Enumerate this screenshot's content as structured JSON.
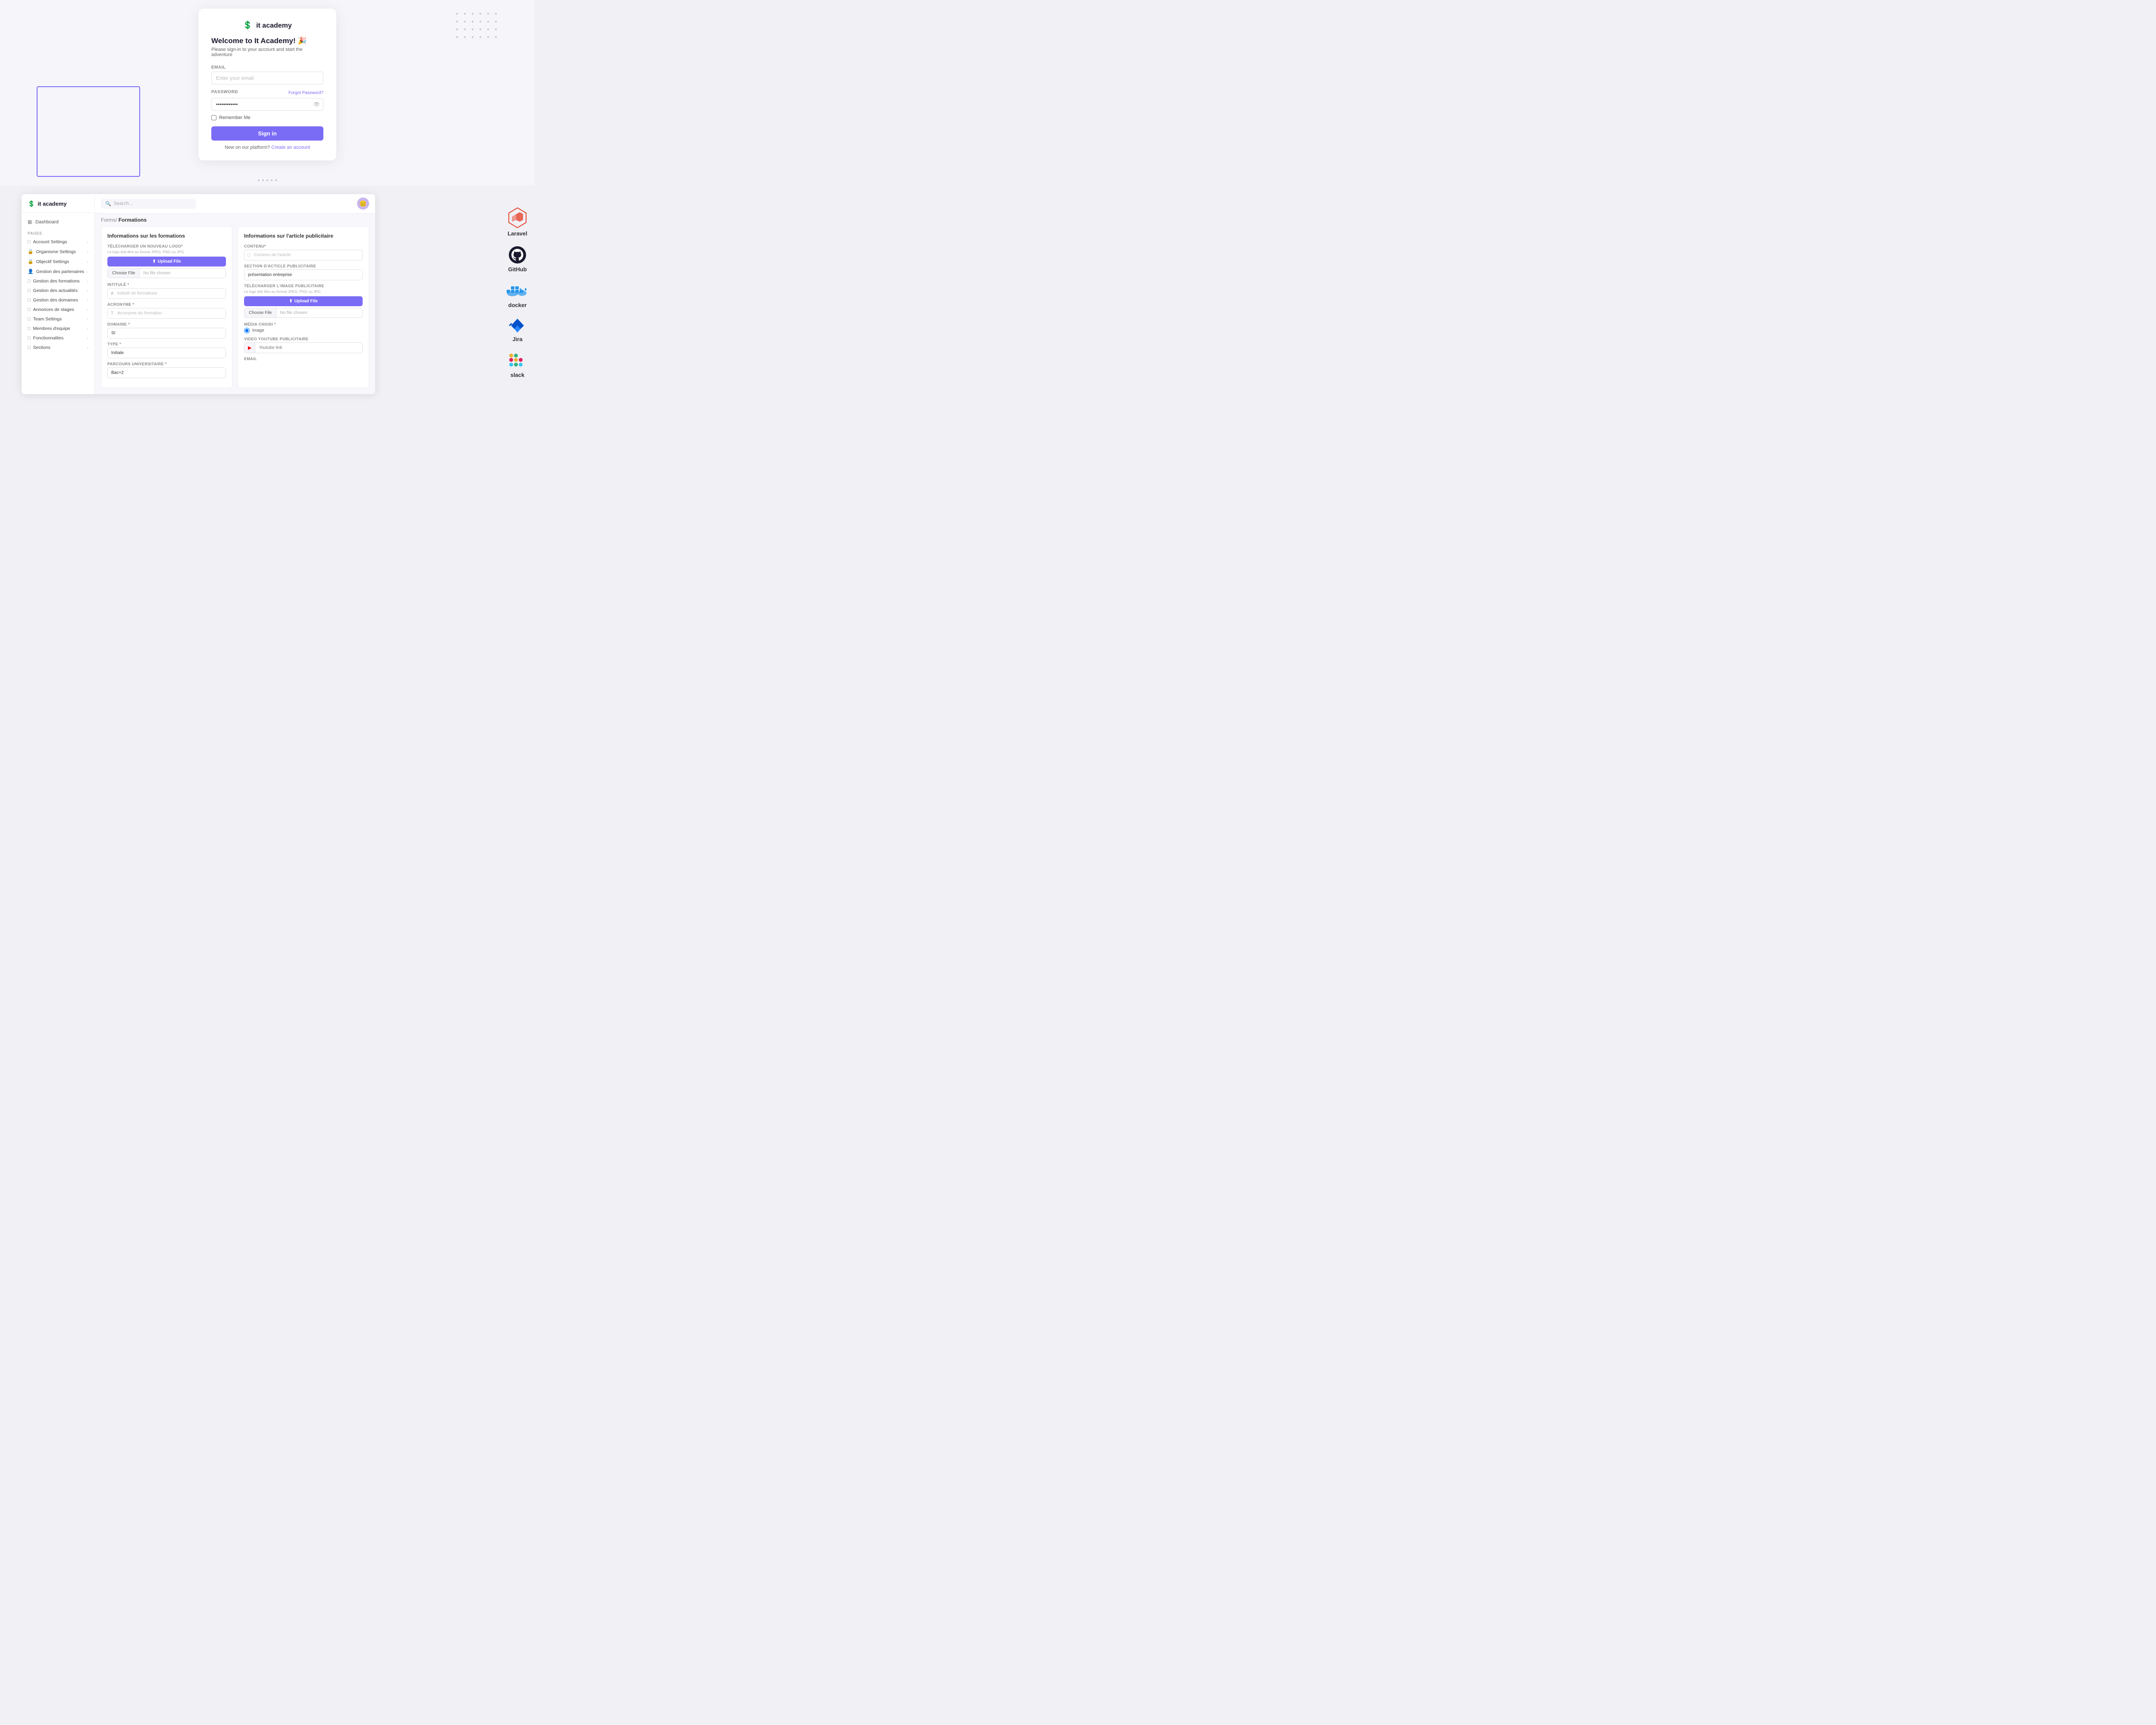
{
  "topSection": {
    "loginCard": {
      "logoIcon": "💲",
      "logoText": "it academy",
      "title": "Welcome to It Academy! 🎉",
      "subtitle": "Please sign-in to your account and start the adventure",
      "emailLabel": "EMAIL",
      "emailPlaceholder": "Enter your email",
      "passwordLabel": "PASSWORD",
      "forgotLink": "Forgot Password?",
      "passwordValue": "············",
      "rememberLabel": "Remember Me",
      "signInButton": "Sign in",
      "newOnPlatform": "New on our platform?",
      "createAccountLink": "Create an account"
    }
  },
  "sidebar": {
    "logoIcon": "💲",
    "logoText": "it academy",
    "dashboardLabel": "Dashboard",
    "pagesLabel": "PAGES",
    "items": [
      {
        "icon": "□",
        "label": "Account Settings",
        "hasChevron": true
      },
      {
        "icon": "🔒",
        "label": "Organisme Settings",
        "hasChevron": true
      },
      {
        "icon": "🔒",
        "label": "Objectif Settings",
        "hasChevron": true
      },
      {
        "icon": "👤",
        "label": "Gestion des partenaires",
        "hasChevron": true
      },
      {
        "icon": "□",
        "label": "Gestion des formations",
        "hasChevron": true
      },
      {
        "icon": "□",
        "label": "Gestion des actualités",
        "hasChevron": true
      },
      {
        "icon": "□",
        "label": "Gestion des domaines",
        "hasChevron": true
      },
      {
        "icon": "□",
        "label": "Annonces de stages",
        "hasChevron": true
      },
      {
        "icon": "□",
        "label": "Team Settings",
        "hasChevron": true
      },
      {
        "icon": "□",
        "label": "Membres d'equipe",
        "hasChevron": true
      },
      {
        "icon": "□",
        "label": "Fonctionnalites",
        "hasChevron": true
      },
      {
        "icon": "□",
        "label": "Sections",
        "hasChevron": true
      }
    ]
  },
  "topBar": {
    "searchPlaceholder": "Search...",
    "avatarAlt": "user avatar"
  },
  "breadcrumb": {
    "link": "Forms/",
    "current": "Formations"
  },
  "leftPanel": {
    "title": "Informations sur les formations",
    "logoSection": {
      "label": "TÉLÉCHARGER UN NOUVEAU LOGO*",
      "hint": "Le logo doit être au format JPEG, PNG ou JPG",
      "uploadButton": "Upload File",
      "chooseFileButton": "Choose File",
      "fileChosen": "No file chosen"
    },
    "intituleLabel": "INTITULÉ *",
    "intitulePlaceholder": "Intitulé de formations",
    "acronymeLabel": "ACRONYME *",
    "acronymePlaceholder": "Acronyme du formation",
    "domaineLabel": "DOMAINE *",
    "domaineValue": "SI",
    "typeLabel": "TYPE *",
    "typeValue": "Initiale",
    "parcoursLabel": "PARCOURS UNIVERSITAIRE *",
    "parcoursValue": "Bac+2"
  },
  "rightPanel": {
    "title": "Informations sur l'article publicitaire",
    "contenuLabel": "CONTENU*",
    "contenuPlaceholder": "Contenu de l'article",
    "sectionLabel": "SECTION D'ACTICLE PUBLICITAIRE",
    "sectionValue": "présentation entreprise",
    "imageLabel": "TÉLÉCHARGER L'IMAGE PUBLICITAIRE",
    "imageHint": "Le logo doit être au format JPEG, PNG ou JPG",
    "uploadButton": "Upload File",
    "chooseFileButton": "Choose File",
    "fileChosen": "No file chosen",
    "mediaLabel": "Média choisi *",
    "mediaValue": "Image",
    "youtubeLabel": "VIDEO YOUTUBE PUBLICITAIRE",
    "youtubePlaceholder": "Youtube link",
    "emailLabel": "EMAIL"
  },
  "rightLogos": [
    {
      "name": "Laravel",
      "color": "#e74430"
    },
    {
      "name": "GitHub",
      "color": "#1a1a2e"
    },
    {
      "name": "docker",
      "color": "#2496ed"
    },
    {
      "name": "Jira",
      "color": "#0052cc"
    },
    {
      "name": "slack",
      "color": "#4a154b"
    }
  ]
}
